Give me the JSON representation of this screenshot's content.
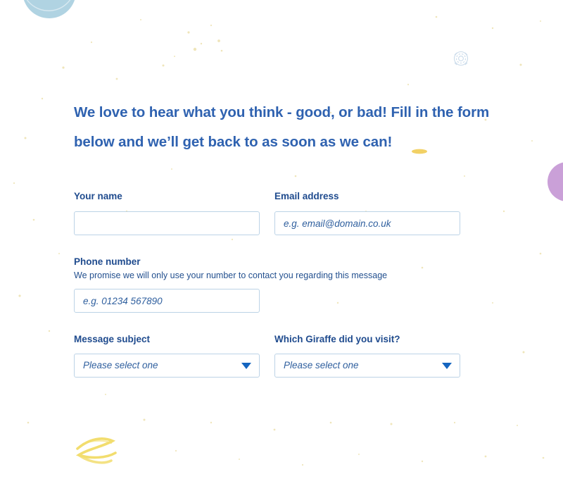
{
  "heading": {
    "text": "We love to hear what you think - good, or bad! Fill in the form below and we’ll get back to as soon as we can!",
    "color": "#2f62b0"
  },
  "form": {
    "fields": [
      {
        "name": "your-name",
        "label": "Your name",
        "placeholder": "",
        "value": ""
      },
      {
        "name": "email-address",
        "label": "Email address",
        "placeholder": "e.g. email@domain.co.uk",
        "value": ""
      },
      {
        "name": "phone-number",
        "label": "Phone number",
        "help": "We promise we will only use your number to contact you regarding this message",
        "placeholder": "e.g. 01234 567890",
        "value": ""
      },
      {
        "name": "message-subject",
        "label": "Message subject",
        "selected": "Please select one"
      },
      {
        "name": "which-giraffe",
        "label": "Which Giraffe did you visit?",
        "selected": "Please select one"
      }
    ]
  },
  "theme": {
    "label_color": "#1f4b8e",
    "help_color": "#23508f",
    "input_text_color": "#2f5f9e",
    "input_border_color": "#bcd3e6",
    "arrow_color": "#1565c0",
    "page_background": "#ffffff",
    "speckle_color": "#e8d98a",
    "circle_blue": "#a9cfdf",
    "circle_purple": "#c79bd6",
    "squiggle_color": "#f2dd6e"
  },
  "decor": {
    "items": [
      {
        "name": "blue-circle",
        "shape": "circle"
      },
      {
        "name": "purple-circle",
        "shape": "circle"
      },
      {
        "name": "spiral-doodle",
        "shape": "spiral"
      },
      {
        "name": "yellow-squiggle",
        "shape": "squiggle"
      },
      {
        "name": "yellow-dash",
        "shape": "dash"
      },
      {
        "name": "paper-speckles",
        "shape": "speckles"
      }
    ]
  }
}
